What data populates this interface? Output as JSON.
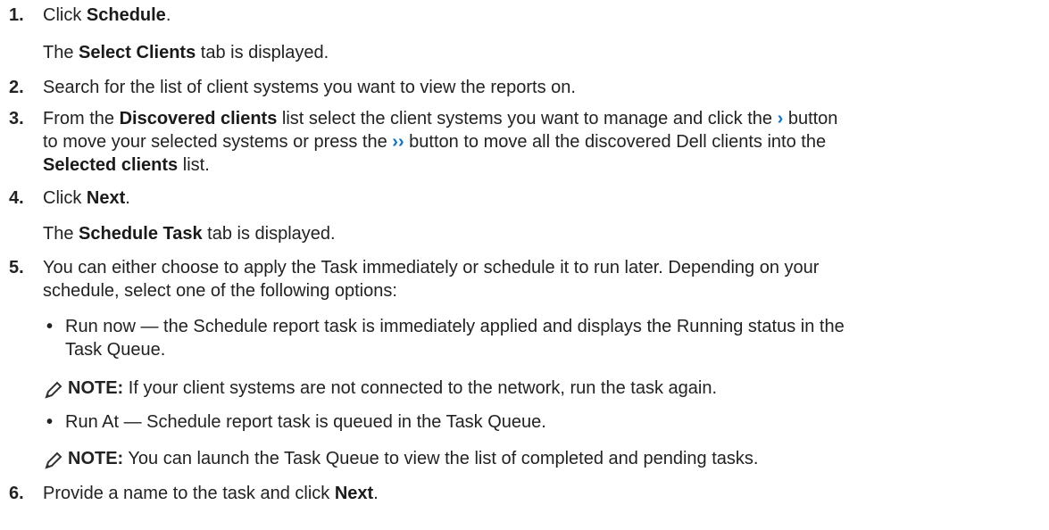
{
  "steps": [
    {
      "num": "1.",
      "pre": "Click ",
      "bold": "Schedule",
      "post": "."
    },
    {
      "pre": "The ",
      "bold": "Select Clients",
      "post": " tab is displayed."
    },
    {
      "num": "2.",
      "text": "Search for the list of client systems you want to view the reports on."
    },
    {
      "num": "3.",
      "pre": "From the ",
      "bold": "Discovered clients",
      "mid": " list select the client systems you want to manage and click the ",
      "icon": "›",
      "post": " button"
    },
    {
      "pre": "to move your selected systems or press the ",
      "icon": "››",
      "post": " button to move all the discovered Dell clients into the"
    },
    {
      "bold": "Selected clients",
      "post": " list."
    },
    {
      "num": "4.",
      "pre": "Click ",
      "bold": "Next",
      "post": "."
    },
    {
      "pre": "The ",
      "bold": "Schedule Task",
      "post": " tab is displayed."
    },
    {
      "num": "5.",
      "text": "You can either choose to apply the Task immediately or schedule it to run later. Depending on your"
    },
    {
      "text": "schedule, select one of the following options:"
    },
    {
      "text": "Run now — the Schedule report task is immediately applied and displays the Running status in the"
    },
    {
      "text": "Task Queue."
    },
    {
      "label": "NOTE:",
      "text": " If your client systems are not connected to the network, run the task again."
    },
    {
      "text": "Run At — Schedule report task is queued in the Task Queue."
    },
    {
      "label": "NOTE:",
      "text": " You can launch the Task Queue to view the list of completed and pending tasks."
    },
    {
      "num": "6.",
      "pre": "Provide a name to the task and click ",
      "bold": "Next",
      "post": "."
    }
  ],
  "bullet_glyph": "•",
  "note_icon": "pencil-note-icon"
}
